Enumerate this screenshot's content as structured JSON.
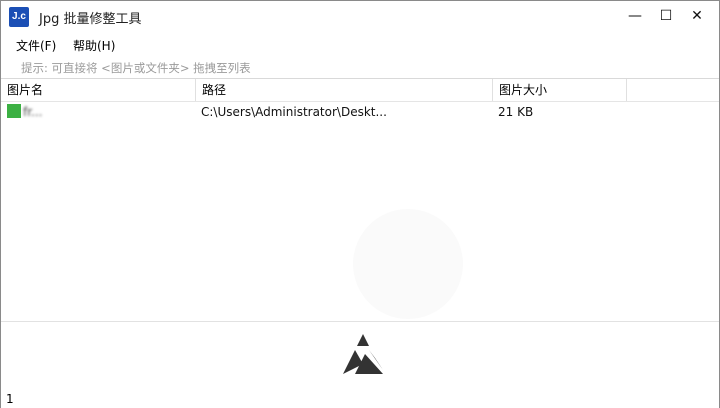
{
  "window": {
    "title": "Jpg 批量修整工具",
    "icon_label": "J.c",
    "buttons": {
      "minimize": "—",
      "maximize": "☐",
      "close": "✕"
    }
  },
  "menu": [
    {
      "label": "文件(F)"
    },
    {
      "label": "帮助(H)"
    }
  ],
  "hint": "提示: 可直接将 <图片或文件夹> 拖拽至列表",
  "table": {
    "columns": [
      "图片名",
      "路径",
      "图片大小",
      ""
    ],
    "rows": [
      {
        "name": "fr...",
        "path": "C:\\Users\\Administrator\\Deskt...",
        "size": "21 KB"
      }
    ]
  },
  "status": {
    "count": "1"
  },
  "colors": {
    "accent": "#1b4fb5",
    "file_icon": "#3cb043"
  },
  "icons": {
    "app": "app-logo-icon",
    "file": "image-file-icon",
    "brand": "triangle-logo-icon"
  }
}
